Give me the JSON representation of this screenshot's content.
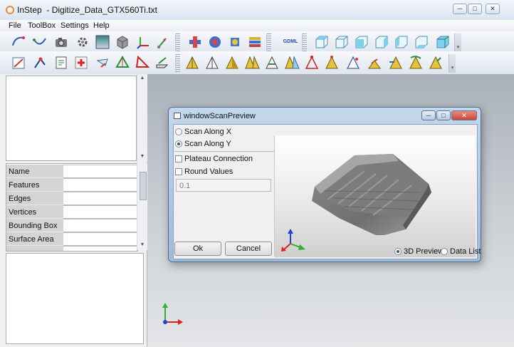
{
  "window": {
    "title": "InStep  - Digitize_Data_GTX560Ti.txt",
    "minimize_glyph": "─",
    "maximize_glyph": "□",
    "close_glyph": "✕"
  },
  "menu": {
    "items": [
      "File",
      "ToolBox",
      "Settings",
      "Help"
    ]
  },
  "toolbar1": {
    "gdml_label": "GDML"
  },
  "properties": {
    "rows": [
      "Name",
      "Features",
      "Edges",
      "Vertices",
      "Bounding Box",
      "Surface Area"
    ]
  },
  "dialog": {
    "title": "windowScanPreview",
    "scan_x_label": "Scan Along X",
    "scan_y_label": "Scan Along Y",
    "scan_selected": "Y",
    "plateau_label": "Plateau Connection",
    "plateau_checked": false,
    "round_label": "Round Values",
    "round_checked": false,
    "round_value": "0.1",
    "ok_label": "Ok",
    "cancel_label": "Cancel",
    "view_3d_label": "3D Preview",
    "view_list_label": "Data List",
    "view_selected": "3D Preview"
  },
  "colors": {
    "axis_x": "#e02020",
    "axis_y": "#2bb12b",
    "axis_z": "#2040e0",
    "dialog_border": "#4f6f93",
    "close_button": "#c9463d"
  },
  "icons": {
    "toolbar1": [
      "curve-arc-icon",
      "curve-line-icon",
      "camera-icon",
      "gear-wrench-icon",
      "color-gradient-icon",
      "cube-solid-icon",
      "axis-transform-icon",
      "spline-arrow-icon",
      "boolean-union-icon",
      "boolean-subtract-icon",
      "boolean-intersect-icon",
      "layers-icon",
      "gdml-icon",
      "view-top-icon",
      "view-front-icon",
      "view-right-icon",
      "view-back-icon",
      "view-left-icon",
      "view-bottom-icon",
      "view-iso-icon"
    ],
    "toolbar2": [
      "measure-icon",
      "pick-point-icon",
      "edit-doc-icon",
      "add-red-icon",
      "plane-arrow-icon",
      "plane-tilt-icon",
      "triangle-icon",
      "sketch-icon",
      "prism-icon",
      "prism-edge-icon",
      "prism-face-icon",
      "prism-multi-icon",
      "prism-slice-icon",
      "prism-split-icon",
      "prism-edges-icon",
      "prism-wire-icon",
      "prism-pick-icon",
      "prism-node-icon",
      "prism-sweep-icon",
      "prism-rotate-icon",
      "prism-cut-icon",
      "prism-merge-icon"
    ]
  }
}
